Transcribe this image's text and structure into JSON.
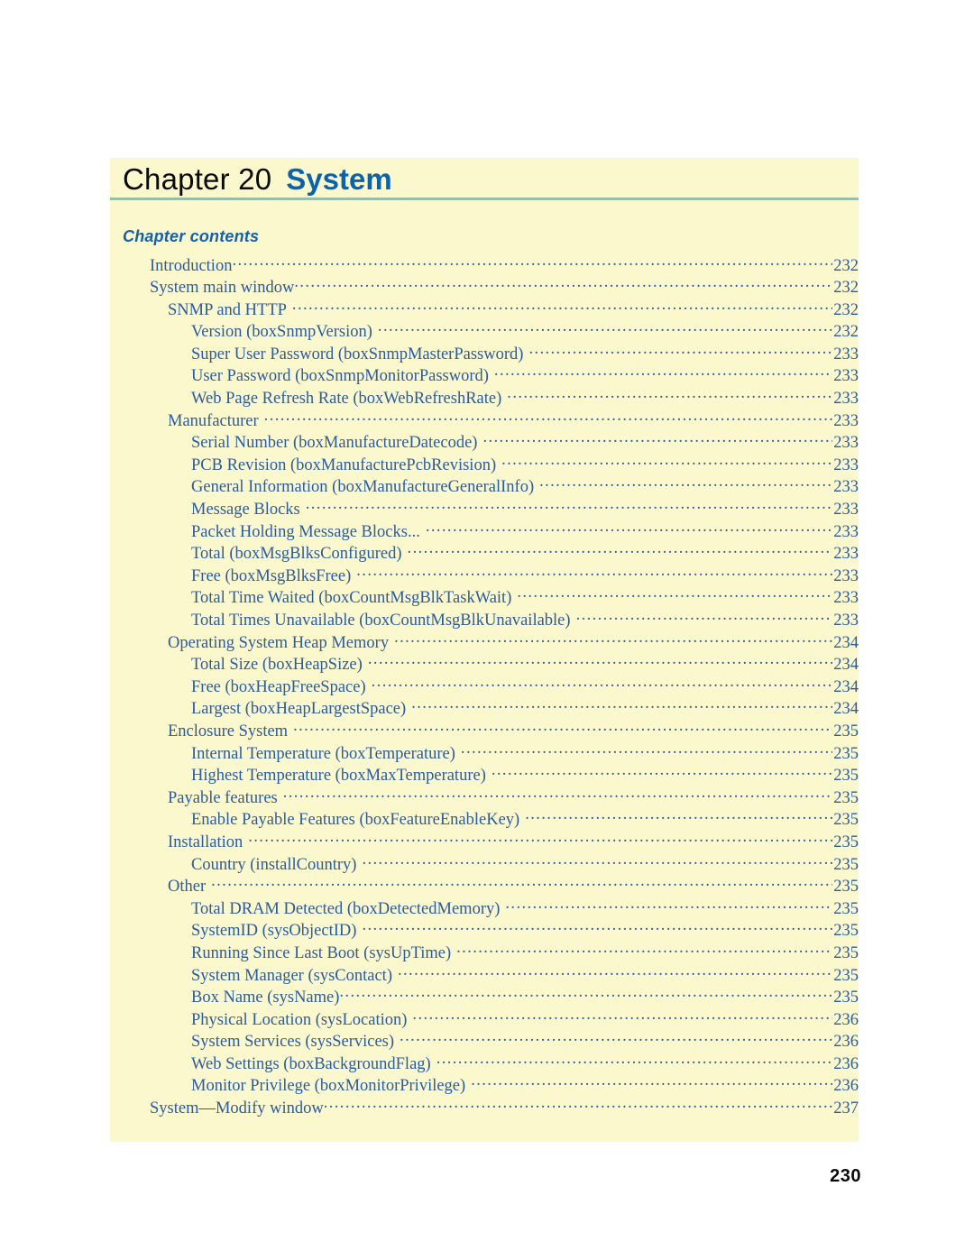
{
  "colors": {
    "panel_background": "#fcf8ce",
    "page_background": "#ffffff",
    "title_accent": "#0b63b0",
    "title_text": "#0a0a0a",
    "divider": "#7fc6c0",
    "toc_text": "#2b5c9e",
    "heading": "#1161ad",
    "folio": "#0a0a0a"
  },
  "header": {
    "chapter_label": "Chapter 20",
    "chapter_title": "System"
  },
  "contents": {
    "heading": "Chapter contents",
    "entries": [
      {
        "label": "Introduction",
        "page": "232",
        "level": 0,
        "gap": false
      },
      {
        "label": "System main window",
        "page": "232",
        "level": 0,
        "gap": false
      },
      {
        "label": "SNMP and HTTP",
        "page": "232",
        "level": 1,
        "gap": true
      },
      {
        "label": "Version (boxSnmpVersion)",
        "page": "232",
        "level": 2,
        "gap": true
      },
      {
        "label": "Super User Password (boxSnmpMasterPassword)",
        "page": "233",
        "level": 2,
        "gap": true
      },
      {
        "label": "User Password (boxSnmpMonitorPassword)",
        "page": "233",
        "level": 2,
        "gap": true
      },
      {
        "label": "Web Page Refresh Rate (boxWebRefreshRate)",
        "page": "233",
        "level": 2,
        "gap": true
      },
      {
        "label": "Manufacturer",
        "page": "233",
        "level": 1,
        "gap": true
      },
      {
        "label": "Serial Number (boxManufactureDatecode)",
        "page": "233",
        "level": 2,
        "gap": true
      },
      {
        "label": "PCB Revision (boxManufacturePcbRevision)",
        "page": "233",
        "level": 2,
        "gap": true
      },
      {
        "label": "General Information (boxManufactureGeneralInfo)",
        "page": "233",
        "level": 2,
        "gap": true
      },
      {
        "label": "Message Blocks",
        "page": "233",
        "level": 2,
        "gap": true
      },
      {
        "label": "Packet Holding Message Blocks...",
        "page": "233",
        "level": 2,
        "gap": true
      },
      {
        "label": "Total (boxMsgBlksConfigured)",
        "page": "233",
        "level": 2,
        "gap": true
      },
      {
        "label": "Free (boxMsgBlksFree)",
        "page": "233",
        "level": 2,
        "gap": true
      },
      {
        "label": "Total Time Waited (boxCountMsgBlkTaskWait)",
        "page": "233",
        "level": 2,
        "gap": true
      },
      {
        "label": "Total Times Unavailable (boxCountMsgBlkUnavailable)",
        "page": "233",
        "level": 2,
        "gap": true
      },
      {
        "label": "Operating System Heap Memory",
        "page": "234",
        "level": 1,
        "gap": true
      },
      {
        "label": "Total Size (boxHeapSize)",
        "page": "234",
        "level": 2,
        "gap": true
      },
      {
        "label": "Free (boxHeapFreeSpace)",
        "page": "234",
        "level": 2,
        "gap": true
      },
      {
        "label": "Largest (boxHeapLargestSpace)",
        "page": "234",
        "level": 2,
        "gap": true
      },
      {
        "label": "Enclosure System",
        "page": "235",
        "level": 1,
        "gap": true
      },
      {
        "label": "Internal Temperature (boxTemperature)",
        "page": "235",
        "level": 2,
        "gap": true
      },
      {
        "label": "Highest Temperature (boxMaxTemperature)",
        "page": "235",
        "level": 2,
        "gap": true
      },
      {
        "label": "Payable features",
        "page": "235",
        "level": 1,
        "gap": true
      },
      {
        "label": "Enable Payable Features (boxFeatureEnableKey)",
        "page": "235",
        "level": 2,
        "gap": true
      },
      {
        "label": "Installation",
        "page": "235",
        "level": 1,
        "gap": true
      },
      {
        "label": "Country (installCountry)",
        "page": "235",
        "level": 2,
        "gap": true
      },
      {
        "label": "Other",
        "page": "235",
        "level": 1,
        "gap": true
      },
      {
        "label": "Total DRAM Detected (boxDetectedMemory)",
        "page": "235",
        "level": 2,
        "gap": true
      },
      {
        "label": "SystemID (sysObjectID)",
        "page": "235",
        "level": 2,
        "gap": true
      },
      {
        "label": "Running Since Last Boot (sysUpTime)",
        "page": "235",
        "level": 2,
        "gap": true
      },
      {
        "label": "System Manager (sysContact)",
        "page": "235",
        "level": 2,
        "gap": true
      },
      {
        "label": "Box Name (sysName)",
        "page": "235",
        "level": 2,
        "gap": false
      },
      {
        "label": "Physical Location (sysLocation)",
        "page": "236",
        "level": 2,
        "gap": true
      },
      {
        "label": "System Services (sysServices)",
        "page": "236",
        "level": 2,
        "gap": true
      },
      {
        "label": "Web Settings (boxBackgroundFlag)",
        "page": "236",
        "level": 2,
        "gap": true
      },
      {
        "label": "Monitor Privilege (boxMonitorPrivilege)",
        "page": "236",
        "level": 2,
        "gap": true
      },
      {
        "label": "System—Modify window",
        "page": "237",
        "level": 0,
        "gap": false
      }
    ]
  },
  "footer": {
    "page_number": "230"
  }
}
